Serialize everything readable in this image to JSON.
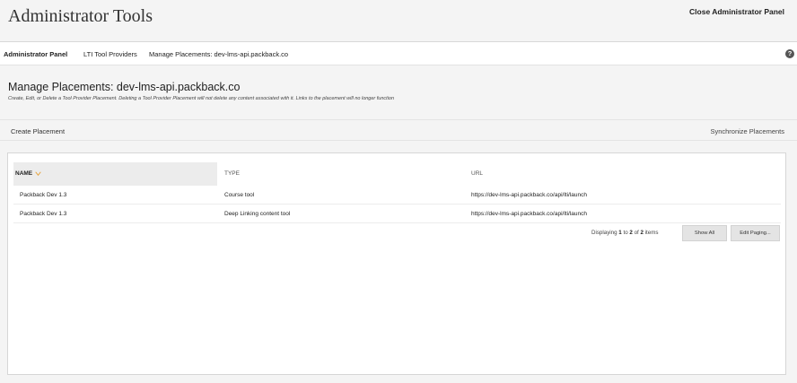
{
  "header": {
    "title": "Administrator Tools",
    "close_label": "Close Administrator Panel"
  },
  "breadcrumb": [
    {
      "label": "Administrator Panel"
    },
    {
      "label": "LTI Tool Providers"
    },
    {
      "label": "Manage Placements: dev-lms-api.packback.co"
    }
  ],
  "help_icon": "?",
  "page": {
    "title": "Manage Placements: dev-lms-api.packback.co",
    "description": "Create, Edit, or Delete a Tool Provider Placement. Deleting a Tool Provider Placement will not delete any content associated with it. Links to the placement will no longer function"
  },
  "actions": {
    "create": "Create Placement",
    "synchronize": "Synchronize Placements"
  },
  "table": {
    "columns": {
      "name": "NAME",
      "type": "TYPE",
      "url": "URL"
    },
    "rows": [
      {
        "name": "Packback Dev 1.3",
        "type": "Course tool",
        "url": "https://dev-lms-api.packback.co/api/lti/launch"
      },
      {
        "name": "Packback Dev 1.3",
        "type": "Deep Linking content tool",
        "url": "https://dev-lms-api.packback.co/api/lti/launch"
      }
    ],
    "sort_icon": "chevron-down-icon"
  },
  "paging": {
    "prefix": "Displaying",
    "from": "1",
    "to_word": "to",
    "to": "2",
    "of_word": "of",
    "total": "2",
    "suffix": "items",
    "show_all": "Show All",
    "edit_paging": "Edit Paging..."
  },
  "colors": {
    "accent_sort": "#e6a23c",
    "background": "#f4f4f4"
  }
}
